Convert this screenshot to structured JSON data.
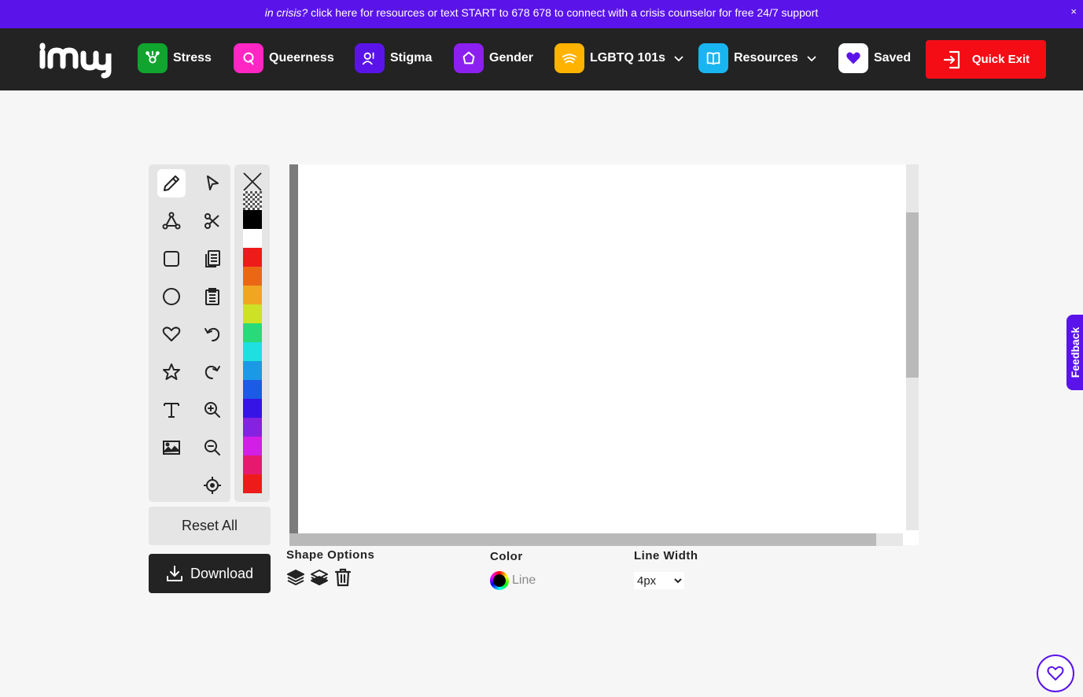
{
  "crisis_banner": {
    "lead": "in crisis?",
    "text": " click here for resources or text START to 678 678 to connect with a crisis counselor for free 24/7 support",
    "close": "×"
  },
  "nav": {
    "items": [
      {
        "label": "Stress",
        "icon": "brain-icon",
        "color": "#0fa52e"
      },
      {
        "label": "Queerness",
        "icon": "q-icon",
        "color": "#ff26c4"
      },
      {
        "label": "Stigma",
        "icon": "people-icon",
        "color": "#5a14ea"
      },
      {
        "label": "Gender",
        "icon": "gender-icon",
        "color": "#8c20f0"
      },
      {
        "label": "LGBTQ 101s",
        "icon": "rainbow-icon",
        "color": "#ffb300"
      },
      {
        "label": "Resources",
        "icon": "book-icon",
        "color": "#19b5f0"
      },
      {
        "label": "Saved",
        "icon": "heart-icon",
        "color": "#ffffff"
      }
    ],
    "quick_exit": "Quick Exit"
  },
  "tools": [
    "pencil-icon",
    "pointer-icon",
    "vector-icon",
    "scissors-icon",
    "square-icon",
    "copy-icon",
    "circle-icon",
    "paste-icon",
    "heart-icon",
    "undo-icon",
    "star-icon",
    "redo-icon",
    "text-icon",
    "zoom-in-icon",
    "image-icon",
    "zoom-out-icon",
    "crosshair-icon"
  ],
  "palette": {
    "colors": [
      "transparent",
      "#000000",
      "#ffffff",
      "#ee1b1b",
      "#ec6714",
      "#f0a620",
      "#cde224",
      "#28da79",
      "#1fdfe0",
      "#1a9ae6",
      "#1c5be6",
      "#3614e6",
      "#8521e0",
      "#d21ee6",
      "#e51a6e",
      "#ee1b1b"
    ]
  },
  "buttons": {
    "reset": "Reset All",
    "download": "Download"
  },
  "options": {
    "shape_label": "Shape Options",
    "color_label": "Color",
    "color_line": "Line",
    "width_label": "Line Width",
    "width_value": "4px",
    "width_options": [
      "4px"
    ]
  },
  "feedback": "Feedback"
}
